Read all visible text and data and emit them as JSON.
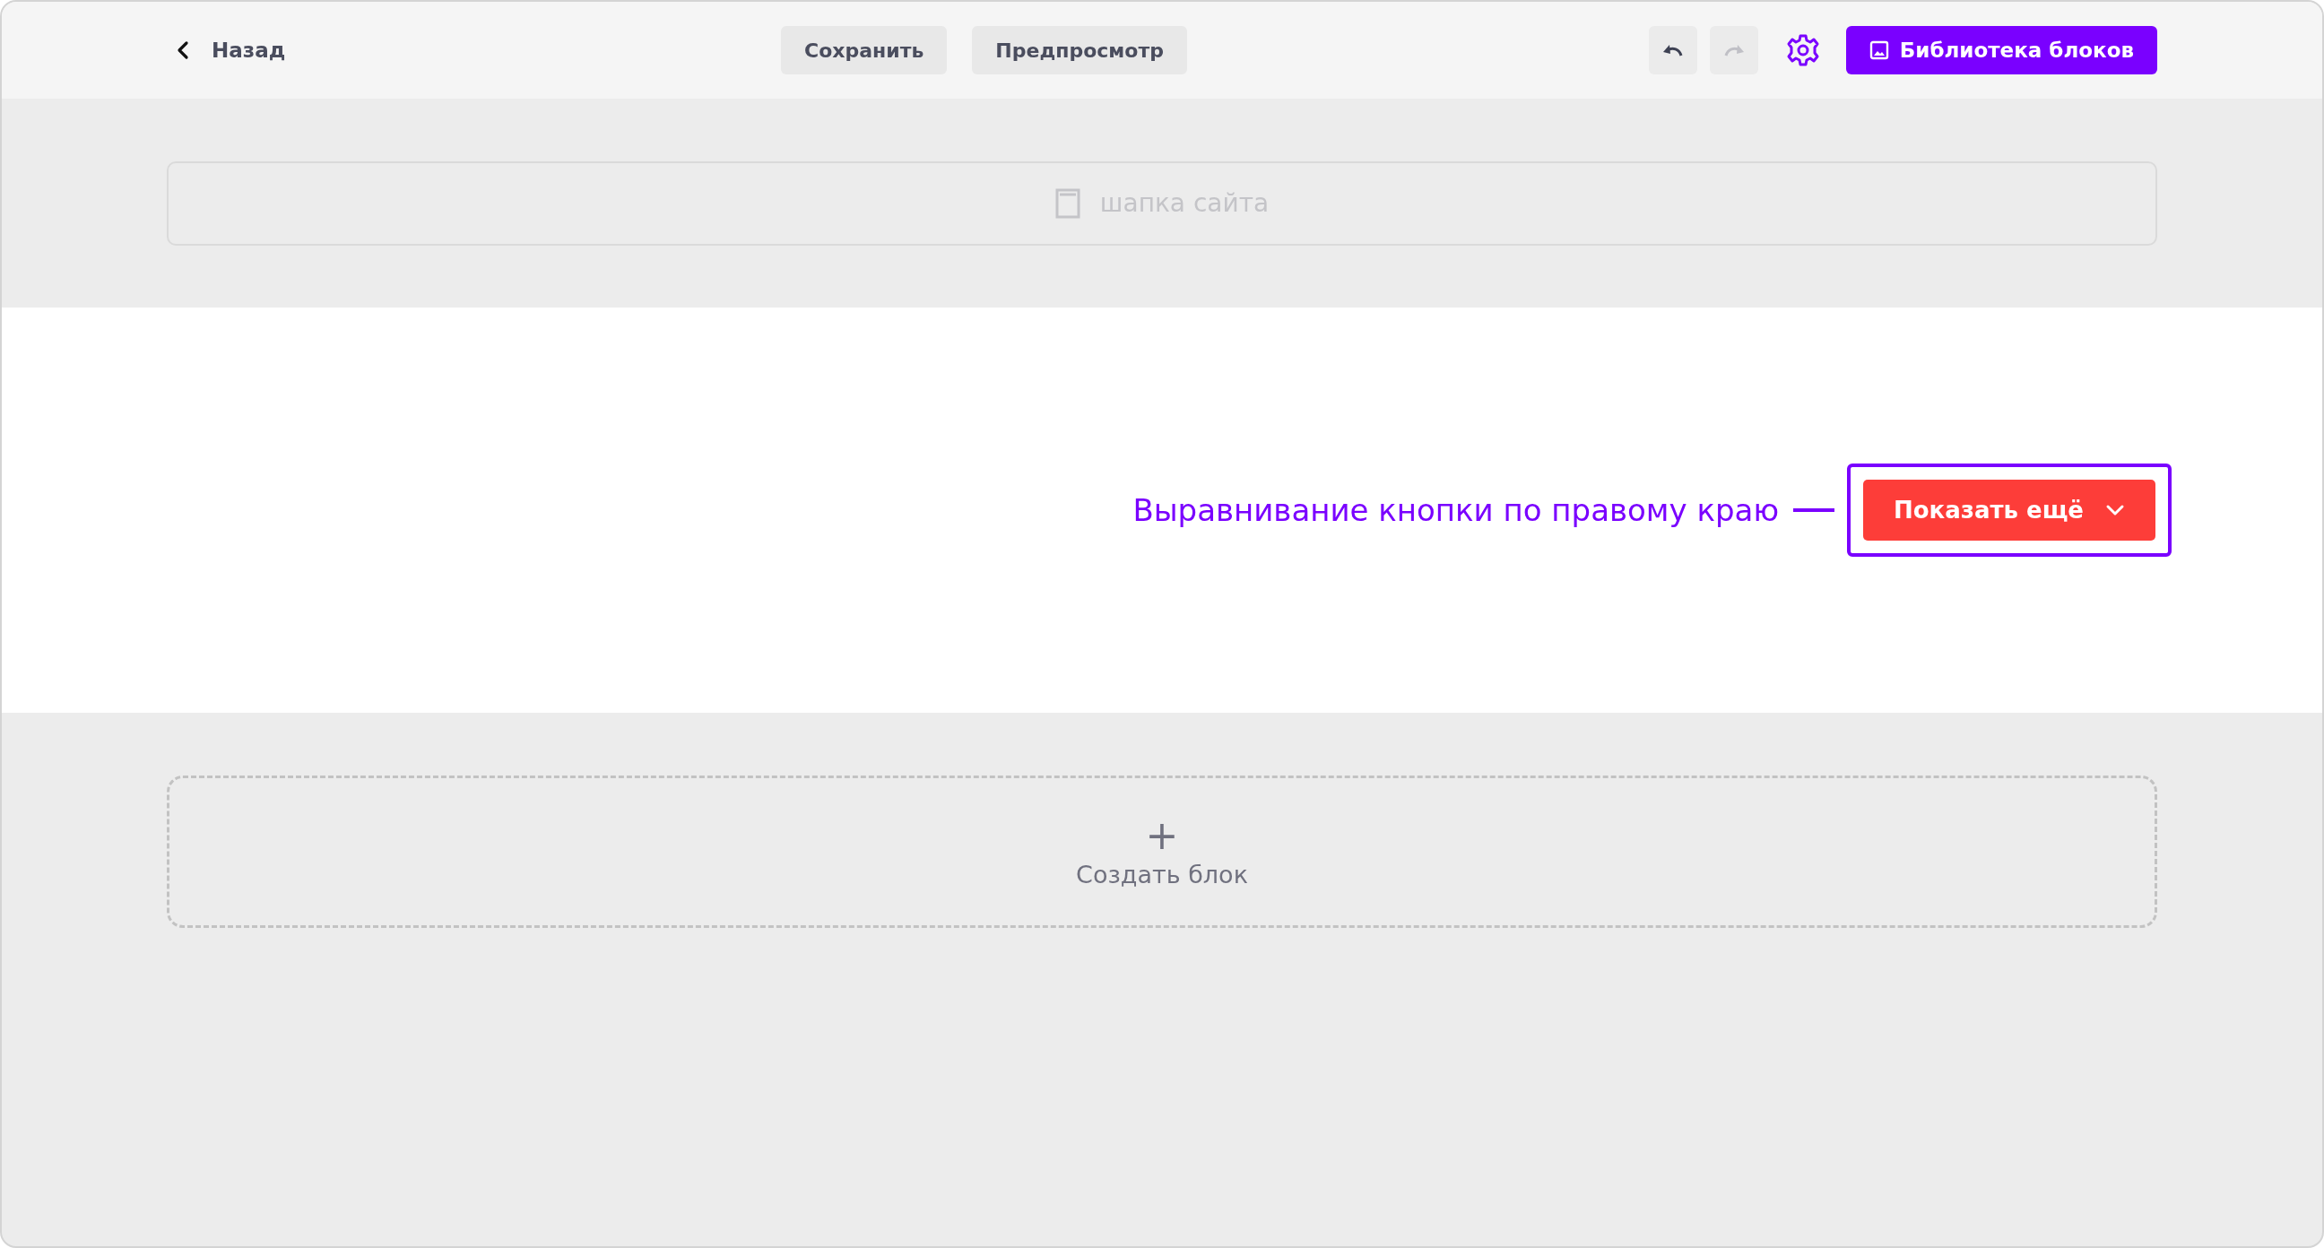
{
  "toolbar": {
    "back": "Назад",
    "buttons": [
      "Сохранить",
      "Предпросмотр"
    ],
    "undo": {
      "disabled": false
    },
    "redo": {
      "disabled": true
    },
    "library": "Библиотека блоков"
  },
  "header_placeholder": "шапка сайта",
  "annotation": "Выравнивание кнопки по правому краю",
  "show_more": {
    "label": "Показать ещё"
  },
  "create_block": {
    "icon": "+",
    "label": "Создать блок"
  }
}
